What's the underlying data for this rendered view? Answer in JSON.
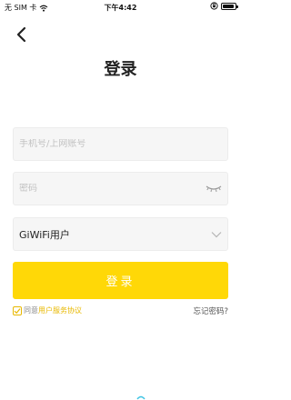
{
  "status_bar": {
    "carrier": "无 SIM 卡",
    "time": "下午4:42",
    "battery_level": 0.9,
    "icons": [
      "wifi-icon",
      "rotation-lock-icon",
      "battery-icon"
    ]
  },
  "header": {
    "back_icon": "chevron-left-icon",
    "title": "登录"
  },
  "form": {
    "account_placeholder": "手机号/上网账号",
    "password_placeholder": "密码",
    "user_type_value": "GiWiFi用户",
    "eye_icon": "eye-closed-icon",
    "dropdown_icon": "chevron-down-icon"
  },
  "actions": {
    "login_label": "登录",
    "agree_prefix": "同意",
    "terms_label": "用户服务协议",
    "forgot_password": "忘记密码?"
  },
  "colors": {
    "accent": "#ffd807",
    "link": "#e8b800",
    "field_bg": "#f6f6f6"
  }
}
